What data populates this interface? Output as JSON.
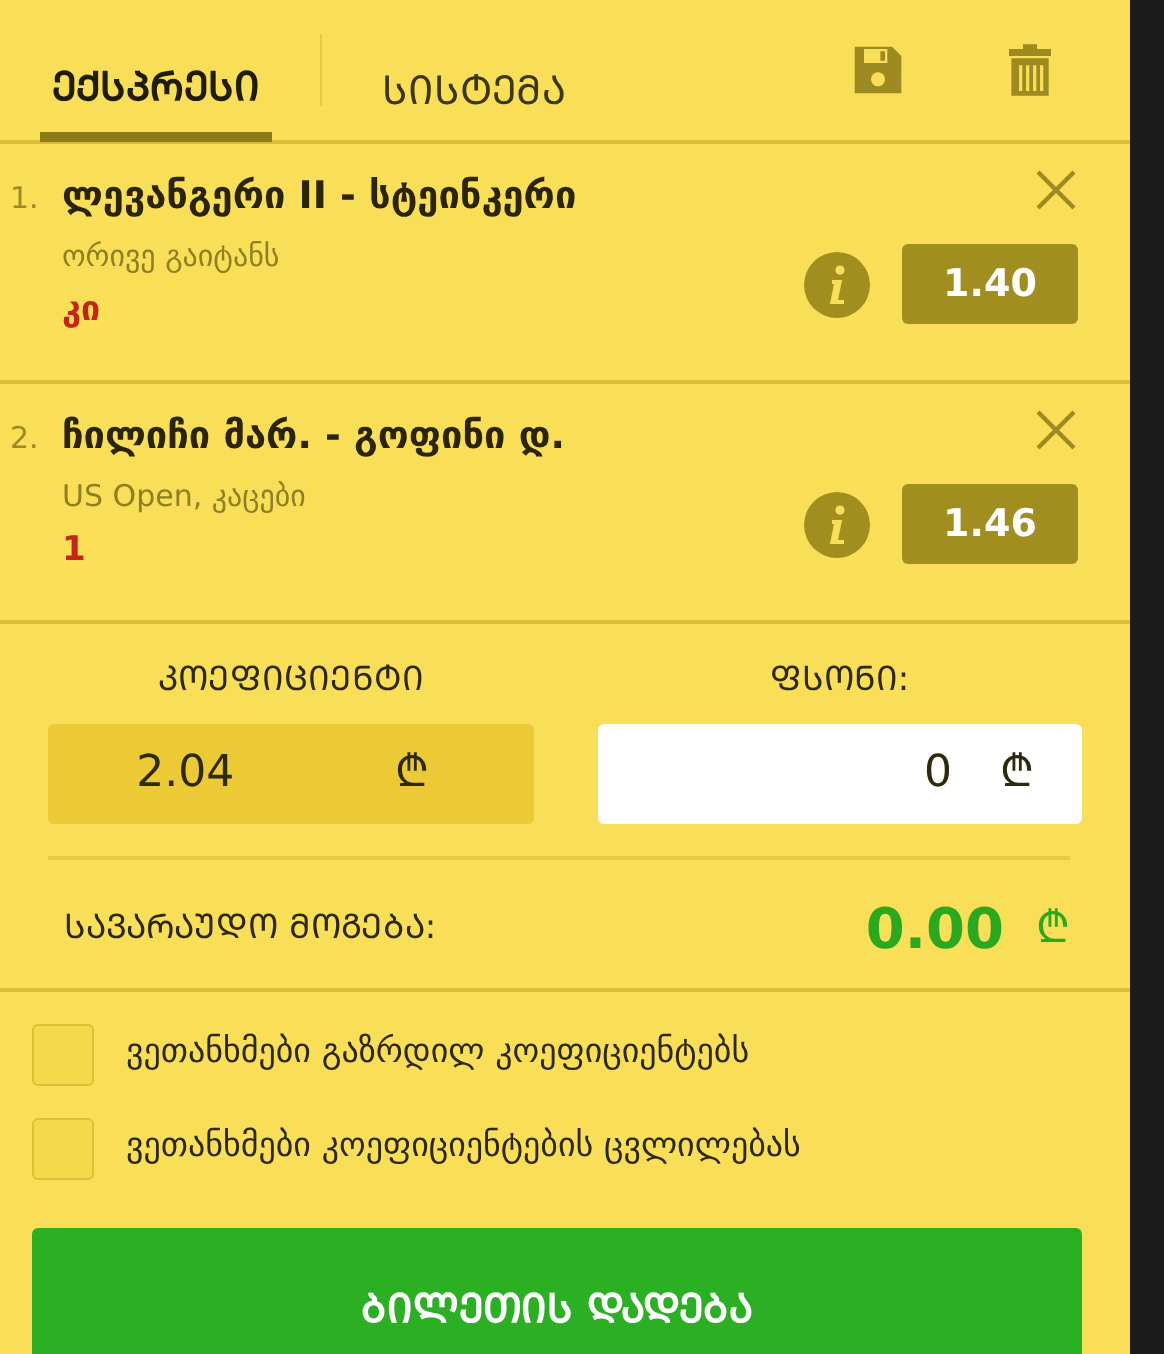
{
  "tabs": [
    {
      "label": "ᲔᲥᲡᲞᲠᲔᲡᲘ",
      "selected": true
    },
    {
      "label": "ᲡᲘᲡᲢᲔᲛᲐ",
      "selected": false
    }
  ],
  "bets": [
    {
      "number": "1.",
      "match": "ლევანგერი II - სტეინკერი",
      "market": "ორივე გაიტანს",
      "pick": "კი",
      "odds": "1.40"
    },
    {
      "number": "2.",
      "match": "ჩილიჩი მარ. - გოფინი დ.",
      "market": "US Open, კაცები",
      "pick": "1",
      "odds": "1.46"
    }
  ],
  "coefficient": {
    "label": "ᲙᲝᲔᲤᲘᲪᲘᲔᲜᲢᲘ",
    "value": "2.04",
    "currency": "₾"
  },
  "stake": {
    "label": "ᲤᲡᲝᲜᲘ:",
    "value": "0",
    "currency": "₾"
  },
  "potential_win": {
    "label": "ᲡᲐᲕᲐᲠᲐᲣᲓᲝ ᲛᲝᲒᲔᲑᲐ:",
    "value": "0.00",
    "currency": "₾"
  },
  "agreements": [
    {
      "label": "ვეთანხმები გაზრდილ კოეფიციენტებს",
      "checked": false
    },
    {
      "label": "ვეთანხმები კოეფიციენტების ცვლილებას",
      "checked": false
    }
  ],
  "submit_button": "ᲑᲘᲚᲔᲗᲘᲡ ᲓᲐᲓᲔᲑᲐ"
}
